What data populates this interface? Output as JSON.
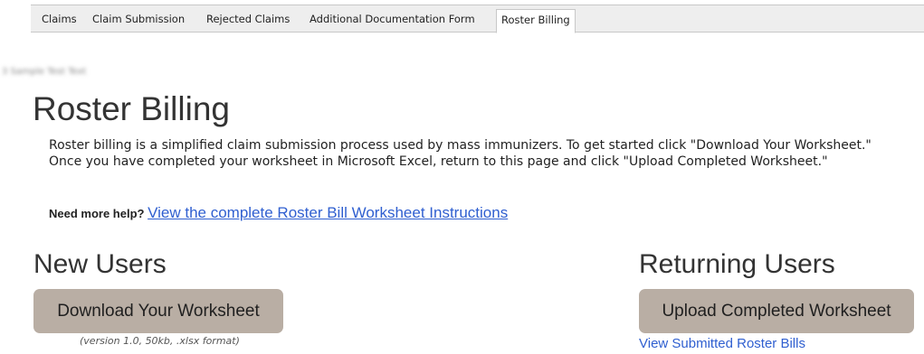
{
  "tabs": [
    {
      "label": "Claims",
      "active": false
    },
    {
      "label": "Claim Submission",
      "active": false
    },
    {
      "label": "Rejected Claims",
      "active": false
    },
    {
      "label": "Additional Documentation Form",
      "active": false
    },
    {
      "label": "Roster Billing",
      "active": true
    }
  ],
  "blurred_text": "3 Sample Test Text",
  "page": {
    "title": "Roster Billing",
    "intro": "Roster billing is a simplified claim submission process used by mass immunizers. To get started click \"Download Your Worksheet.\" Once you have completed your worksheet in Microsoft Excel, return to this page and click \"Upload Completed Worksheet.\"",
    "help_label": "Need more help?",
    "help_link": "View the complete Roster Bill Worksheet Instructions"
  },
  "new_users": {
    "title": "New Users",
    "button": "Download Your Worksheet",
    "note": "(version 1.0, 50kb, .xlsx format)"
  },
  "returning_users": {
    "title": "Returning Users",
    "button": "Upload Completed Worksheet",
    "link": "View Submitted Roster Bills"
  },
  "colors": {
    "button_bg": "#b9aea4",
    "link": "#2f5fd0",
    "tab_bar": "#eeeeee"
  }
}
